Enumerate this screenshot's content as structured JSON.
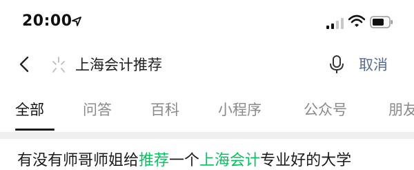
{
  "status_bar": {
    "time": "20:00",
    "icons": [
      "location-arrow-icon",
      "signal-icon",
      "wifi-icon",
      "battery-icon"
    ]
  },
  "search": {
    "query": "上海会计推荐",
    "cancel_label": "取消",
    "icons": [
      "back-icon",
      "sparkle-icon",
      "microphone-icon"
    ]
  },
  "tabs": [
    {
      "label": "全部",
      "active": true
    },
    {
      "label": "问答",
      "active": false
    },
    {
      "label": "百科",
      "active": false
    },
    {
      "label": "小程序",
      "active": false
    },
    {
      "label": "公众号",
      "active": false
    },
    {
      "label": "朋友",
      "active": false
    }
  ],
  "result": {
    "segments": [
      {
        "text": "有没有师哥师姐给",
        "highlight": false
      },
      {
        "text": "推荐",
        "highlight": true
      },
      {
        "text": "一个",
        "highlight": false
      },
      {
        "text": "上海会计",
        "highlight": true
      },
      {
        "text": "专业好的大学",
        "highlight": false
      }
    ]
  },
  "colors": {
    "highlight": "#07c160",
    "cancel": "#576b95",
    "divider": "#efefef"
  }
}
